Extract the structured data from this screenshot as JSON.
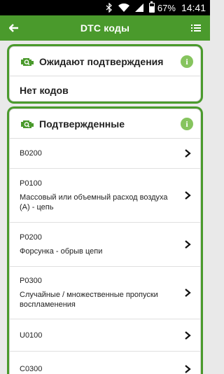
{
  "status_bar": {
    "battery_percent": "67%",
    "time": "14:41"
  },
  "app_bar": {
    "title": "DTC коды"
  },
  "pending": {
    "title": "Ожидают подтверждения",
    "empty_text": "Нет кодов"
  },
  "confirmed": {
    "title": "Подтвержденные",
    "items": [
      {
        "code": "B0200",
        "desc": ""
      },
      {
        "code": "P0100",
        "desc": "Массовый или объемный расход воздуха (А) - цепь"
      },
      {
        "code": "P0200",
        "desc": "Форсунка - обрыв цепи"
      },
      {
        "code": "P0300",
        "desc": "Случайные / множественные пропуски воспламенения"
      },
      {
        "code": "U0100",
        "desc": ""
      },
      {
        "code": "C0300",
        "desc": ""
      }
    ]
  },
  "colors": {
    "accent": "#4a9a2c",
    "info": "#86c45e"
  }
}
